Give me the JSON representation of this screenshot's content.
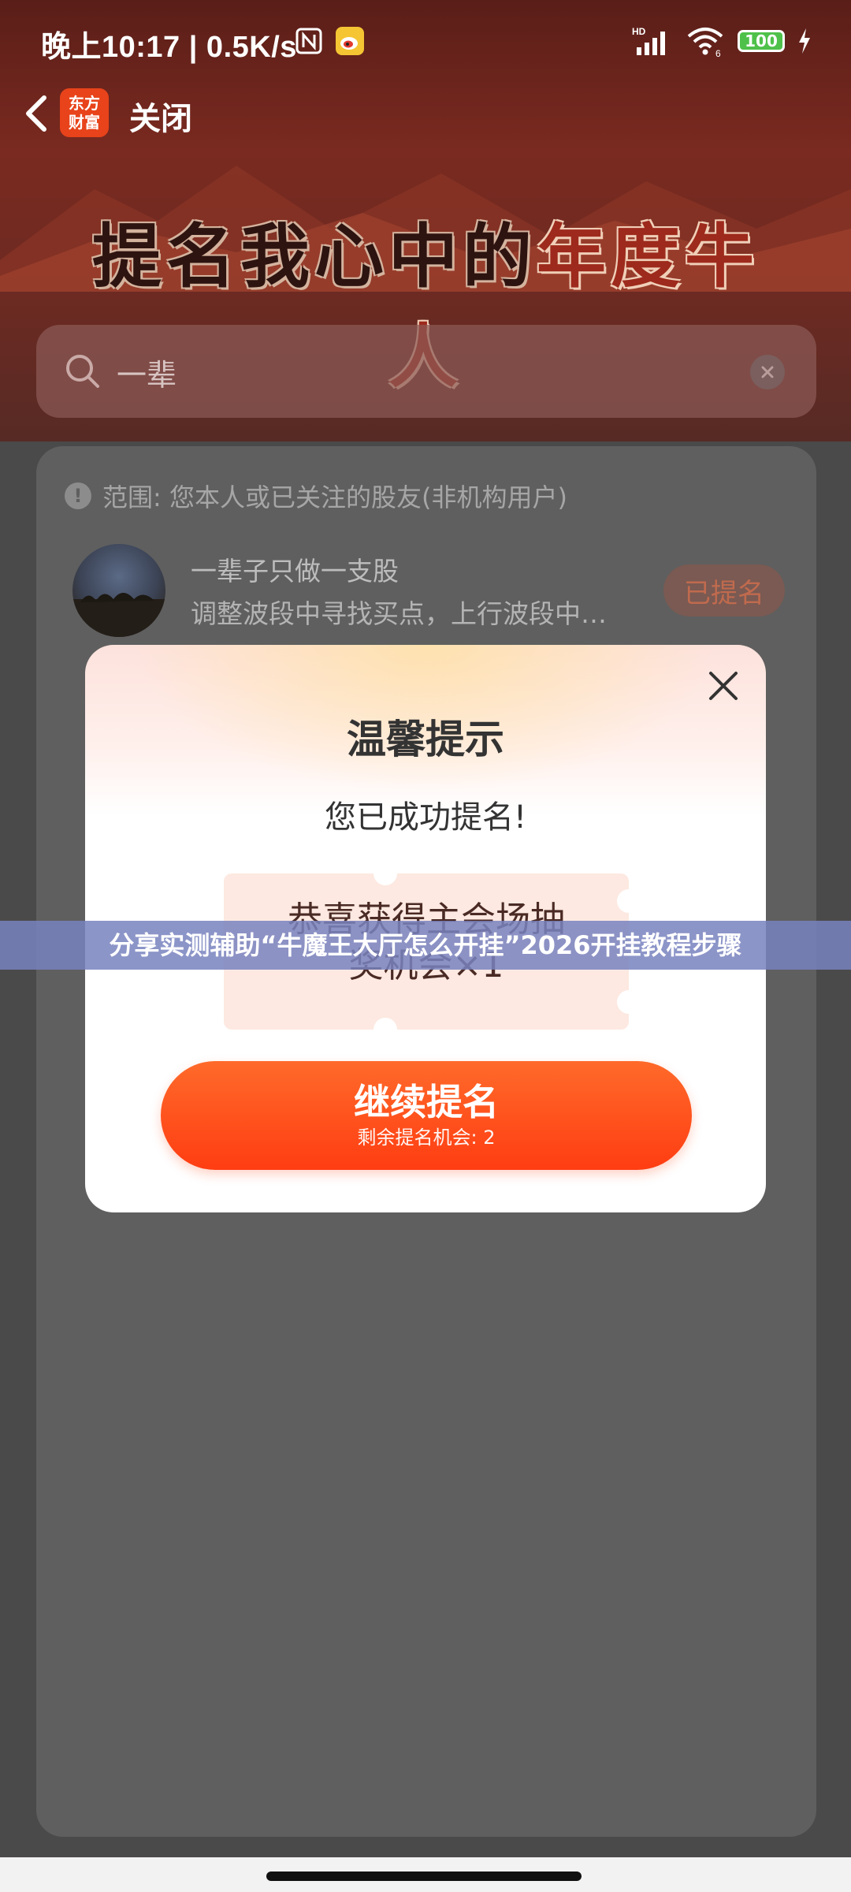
{
  "status_bar": {
    "time_speed": "晚上10:17 | 0.5K/s",
    "signal_label": "HD",
    "battery": "100"
  },
  "nav": {
    "app_logo_line1": "东方",
    "app_logo_line2": "财富",
    "close_label": "关闭"
  },
  "banner": {
    "title_part1": "提名我心中的",
    "title_part2": "年度牛人"
  },
  "search": {
    "value": "一辈"
  },
  "card": {
    "scope_text": "范围: 您本人或已关注的股友(非机构用户)",
    "scope_icon": "!",
    "results": [
      {
        "name": "一辈子只做一支股",
        "desc": "调整波段中寻找买点，上行波段中…",
        "status": "已提名"
      }
    ]
  },
  "overlay": {
    "watermark_text": "分享实测辅助“牛魔王大厅怎么开挂”2026开挂教程步骤"
  },
  "modal": {
    "title": "温馨提示",
    "message": "您已成功提名!",
    "ticket_line1": "恭喜获得主会场抽",
    "ticket_line2": "奖机会×1",
    "button_main": "继续提名",
    "button_sub": "剩余提名机会: 2"
  },
  "colors": {
    "accent": "#ff4a1a",
    "modal_bg": "#ffffff",
    "overlay_band": "#7882be"
  }
}
